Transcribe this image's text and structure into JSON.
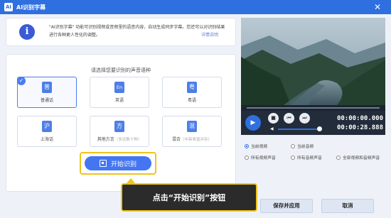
{
  "window": {
    "title": "AI识别字幕",
    "logo_text": "AI",
    "close_glyph": "✕"
  },
  "info": {
    "icon": "i",
    "text": "\"AI识别字幕\" 功能可识别视频或音频里的语音内容，自动生成同步字幕。您还可以对识别结果进行各种更人性化的调整。",
    "link": "详情说明"
  },
  "language_panel": {
    "title": "请选择您要识别的声音语种",
    "options": [
      {
        "glyph": "普",
        "label": "普通话",
        "sub": ""
      },
      {
        "glyph": "En",
        "label": "英语",
        "sub": ""
      },
      {
        "glyph": "粤",
        "label": "粤语",
        "sub": ""
      },
      {
        "glyph": "沪",
        "label": "上海话",
        "sub": ""
      },
      {
        "glyph": "方",
        "label": "其他方言",
        "sub": "（多达数十种）"
      },
      {
        "glyph": "混",
        "label": "混合",
        "sub": "（中英粤普并存）"
      }
    ],
    "selected_index": 0
  },
  "start_button": {
    "label": "开始识别"
  },
  "callout": {
    "text": "点击“开始识别”按钮"
  },
  "player": {
    "current_time": "00:00:00.000",
    "total_time": "00:00:28.888",
    "play_icon": "▶",
    "stop_icon": "■",
    "prev_icon": "⏮",
    "next_icon": "⏭",
    "volume_icon": "◀",
    "volume_level": 1.0
  },
  "source_options": {
    "row1": [
      "当前视频",
      "当前音频"
    ],
    "row2": [
      "所有视频声音",
      "所有音频声音",
      "全部视频和音频声音"
    ],
    "selected": "当前视频"
  },
  "footer": {
    "save_label": "保存并应用",
    "cancel_label": "取消"
  },
  "colors": {
    "accent": "#2f6fe0",
    "highlight": "#f0c419"
  }
}
